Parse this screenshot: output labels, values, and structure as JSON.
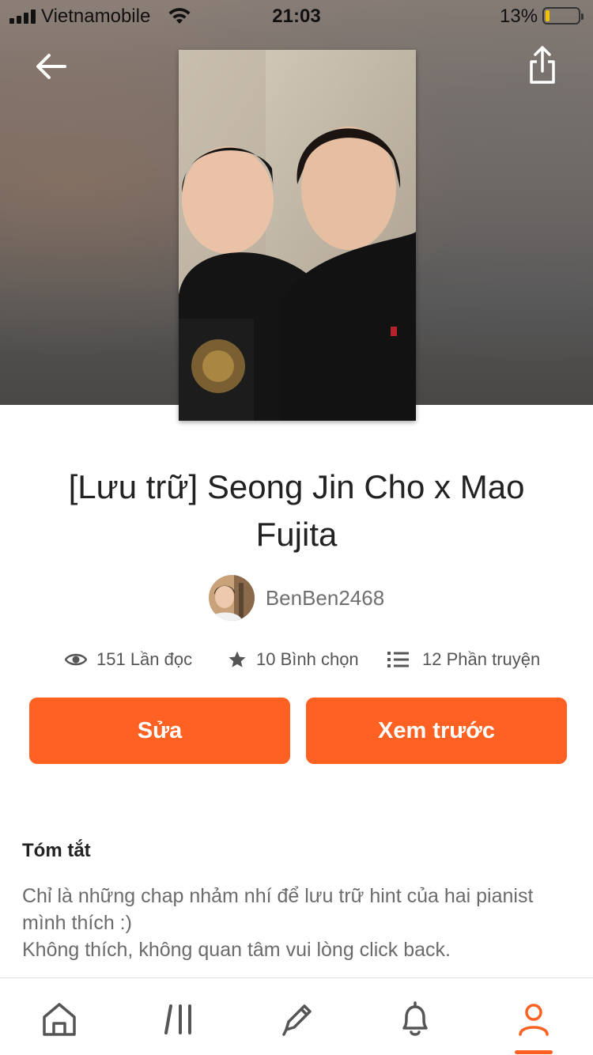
{
  "status_bar": {
    "carrier": "Vietnamobile",
    "time": "21:03",
    "battery": "13%",
    "battery_level": 0.13
  },
  "header": {
    "back_icon": "arrow-left-icon",
    "share_icon": "share-icon"
  },
  "story": {
    "title": "[Lưu trữ] Seong Jin Cho x Mao Fujita",
    "author": "BenBen2468",
    "stats": {
      "reads": "151 Lần đọc",
      "votes": "10 Bình chọn",
      "parts": "12 Phần truyện"
    }
  },
  "actions": {
    "edit_label": "Sửa",
    "preview_label": "Xem trước"
  },
  "summary": {
    "heading": "Tóm tắt",
    "line1": "Chỉ là những chap nhảm nhí để lưu trữ hint của hai pianist mình thích :)",
    "line2": "Không thích, không quan tâm vui lòng click back."
  },
  "bottom_nav": {
    "items": [
      "home-icon",
      "library-icon",
      "write-icon",
      "notifications-icon",
      "profile-icon"
    ],
    "active": "profile-icon"
  },
  "colors": {
    "accent": "#ff6122",
    "text": "#222222",
    "muted": "#6b6b6b"
  }
}
